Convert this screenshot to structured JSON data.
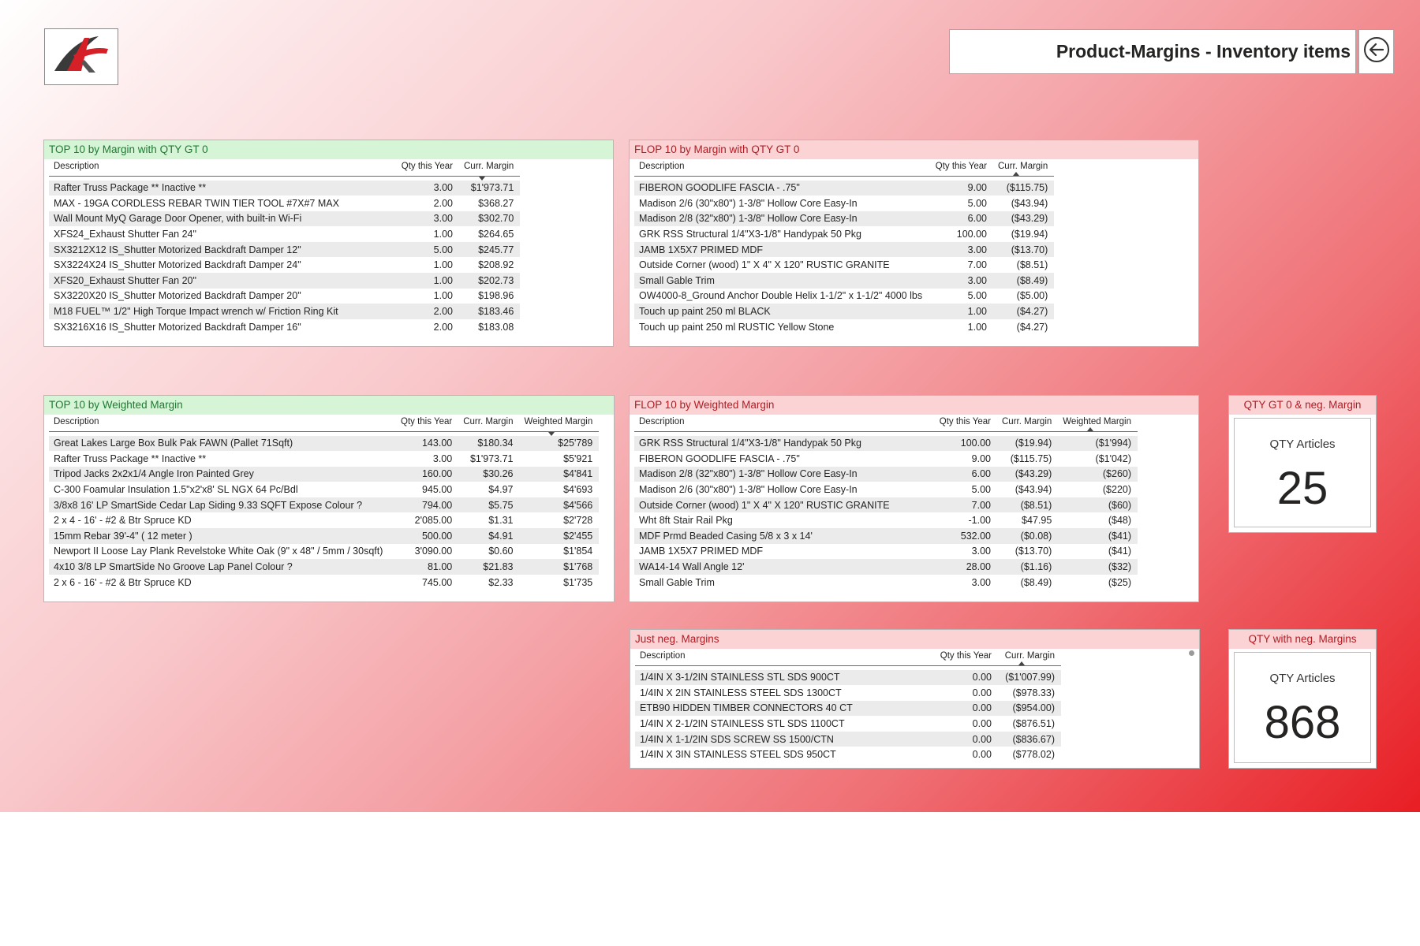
{
  "header": {
    "title": "Product-Margins - Inventory items",
    "logo_icon": "company-logo-icon",
    "back_icon": "back-arrow-icon"
  },
  "colors": {
    "green_header": "#d6f5d6",
    "red_header": "#fbd3d5",
    "background_accent": "#e81e24"
  },
  "top10_margin": {
    "title": "TOP 10 by Margin with QTY GT 0",
    "columns": [
      "Description",
      "Qty this Year",
      "Curr. Margin"
    ],
    "rows": [
      [
        "Rafter Truss Package ** Inactive **",
        "3.00",
        "$1'973.71"
      ],
      [
        "MAX - 19GA CORDLESS REBAR TWIN TIER TOOL #7X#7 MAX",
        "2.00",
        "$368.27"
      ],
      [
        "Wall Mount MyQ Garage Door Opener, with built-in Wi-Fi",
        "3.00",
        "$302.70"
      ],
      [
        "XFS24_Exhaust Shutter Fan 24\"",
        "1.00",
        "$264.65"
      ],
      [
        "SX3212X12 IS_Shutter Motorized Backdraft Damper 12\"",
        "5.00",
        "$245.77"
      ],
      [
        "SX3224X24 IS_Shutter Motorized Backdraft Damper 24\"",
        "1.00",
        "$208.92"
      ],
      [
        "XFS20_Exhaust Shutter Fan 20\"",
        "1.00",
        "$202.73"
      ],
      [
        "SX3220X20 IS_Shutter Motorized Backdraft Damper 20\"",
        "1.00",
        "$198.96"
      ],
      [
        "M18 FUEL™ 1/2\" High Torque Impact wrench w/ Friction Ring Kit",
        "2.00",
        "$183.46"
      ],
      [
        "SX3216X16 IS_Shutter Motorized Backdraft Damper 16\"",
        "2.00",
        "$183.08"
      ]
    ]
  },
  "flop10_margin": {
    "title": "FLOP 10 by Margin with QTY GT 0",
    "columns": [
      "Description",
      "Qty this Year",
      "Curr. Margin"
    ],
    "rows": [
      [
        "FIBERON GOODLIFE FASCIA - .75\"",
        "9.00",
        "($115.75)"
      ],
      [
        "Madison 2/6 (30\"x80\") 1-3/8\" Hollow Core Easy-In",
        "5.00",
        "($43.94)"
      ],
      [
        "Madison 2/8 (32\"x80\") 1-3/8\" Hollow Core Easy-In",
        "6.00",
        "($43.29)"
      ],
      [
        "GRK RSS Structural 1/4\"X3-1/8\" Handypak 50 Pkg",
        "100.00",
        "($19.94)"
      ],
      [
        "JAMB 1X5X7 PRIMED MDF",
        "3.00",
        "($13.70)"
      ],
      [
        "Outside Corner (wood) 1\" X 4\" X 120\" RUSTIC GRANITE",
        "7.00",
        "($8.51)"
      ],
      [
        "Small Gable Trim",
        "3.00",
        "($8.49)"
      ],
      [
        "OW4000-8_Ground Anchor Double Helix 1-1/2\" x 1-1/2\" 4000 lbs",
        "5.00",
        "($5.00)"
      ],
      [
        "Touch up paint 250 ml BLACK",
        "1.00",
        "($4.27)"
      ],
      [
        "Touch up paint 250 ml RUSTIC Yellow Stone",
        "1.00",
        "($4.27)"
      ]
    ]
  },
  "top10_weighted": {
    "title": "TOP 10 by Weighted Margin",
    "columns": [
      "Description",
      "Qty this Year",
      "Curr. Margin",
      "Weighted Margin"
    ],
    "rows": [
      [
        "Great Lakes Large Box Bulk Pak FAWN (Pallet 71Sqft)",
        "143.00",
        "$180.34",
        "$25'789"
      ],
      [
        "Rafter Truss Package ** Inactive **",
        "3.00",
        "$1'973.71",
        "$5'921"
      ],
      [
        "Tripod Jacks 2x2x1/4 Angle Iron Painted Grey",
        "160.00",
        "$30.26",
        "$4'841"
      ],
      [
        "C-300 Foamular Insulation 1.5\"x2'x8' SL NGX 64 Pc/Bdl",
        "945.00",
        "$4.97",
        "$4'693"
      ],
      [
        "3/8x8 16' LP SmartSide Cedar Lap Siding 9.33 SQFT Expose Colour ?",
        "794.00",
        "$5.75",
        "$4'566"
      ],
      [
        "2 x 4 - 16' - #2 & Btr Spruce KD",
        "2'085.00",
        "$1.31",
        "$2'728"
      ],
      [
        "15mm Rebar 39'-4\" ( 12 meter )",
        "500.00",
        "$4.91",
        "$2'455"
      ],
      [
        "Newport II Loose Lay Plank Revelstoke White Oak (9\" x 48\" / 5mm / 30sqft)",
        "3'090.00",
        "$0.60",
        "$1'854"
      ],
      [
        "4x10 3/8 LP SmartSide No Groove Lap Panel Colour ?",
        "81.00",
        "$21.83",
        "$1'768"
      ],
      [
        "2 x 6 - 16' - #2 & Btr Spruce KD",
        "745.00",
        "$2.33",
        "$1'735"
      ]
    ]
  },
  "flop10_weighted": {
    "title": "FLOP 10 by Weighted Margin",
    "columns": [
      "Description",
      "Qty this Year",
      "Curr. Margin",
      "Weighted Margin"
    ],
    "rows": [
      [
        "GRK RSS Structural 1/4\"X3-1/8\" Handypak 50 Pkg",
        "100.00",
        "($19.94)",
        "($1'994)"
      ],
      [
        "FIBERON GOODLIFE FASCIA - .75\"",
        "9.00",
        "($115.75)",
        "($1'042)"
      ],
      [
        "Madison 2/8 (32\"x80\") 1-3/8\" Hollow Core Easy-In",
        "6.00",
        "($43.29)",
        "($260)"
      ],
      [
        "Madison 2/6 (30\"x80\") 1-3/8\" Hollow Core Easy-In",
        "5.00",
        "($43.94)",
        "($220)"
      ],
      [
        "Outside Corner (wood) 1\" X 4\" X 120\" RUSTIC GRANITE",
        "7.00",
        "($8.51)",
        "($60)"
      ],
      [
        "Wht 8ft Stair Rail Pkg",
        "-1.00",
        "$47.95",
        "($48)"
      ],
      [
        "MDF Prmd Beaded Casing 5/8 x 3 x 14'",
        "532.00",
        "($0.08)",
        "($41)"
      ],
      [
        "JAMB 1X5X7 PRIMED MDF",
        "3.00",
        "($13.70)",
        "($41)"
      ],
      [
        "WA14-14 Wall Angle 12'",
        "28.00",
        "($1.16)",
        "($32)"
      ],
      [
        "Small Gable Trim",
        "3.00",
        "($8.49)",
        "($25)"
      ]
    ]
  },
  "neg_margins": {
    "title": "Just neg. Margins",
    "columns": [
      "Description",
      "Qty this Year",
      "Curr. Margin"
    ],
    "rows": [
      [
        "1/4IN X 3-1/2IN STAINLESS STL SDS 900CT",
        "0.00",
        "($1'007.99)"
      ],
      [
        "1/4IN X 2IN STAINLESS STEEL SDS 1300CT",
        "0.00",
        "($978.33)"
      ],
      [
        "ETB90 HIDDEN TIMBER CONNECTORS 40 CT",
        "0.00",
        "($954.00)"
      ],
      [
        "1/4IN X 2-1/2IN STAINLESS STL SDS 1100CT",
        "0.00",
        "($876.51)"
      ],
      [
        "1/4IN X 1-1/2IN SDS SCREW SS 1500/CTN",
        "0.00",
        "($836.67)"
      ],
      [
        "1/4IN X 3IN STAINLESS STEEL SDS 950CT",
        "0.00",
        "($778.02)"
      ]
    ]
  },
  "card_gt0": {
    "title": "QTY GT 0 & neg. Margin",
    "label": "QTY Articles",
    "value": "25"
  },
  "card_neg": {
    "title": "QTY with neg. Margins",
    "label": "QTY Articles",
    "value": "868"
  }
}
